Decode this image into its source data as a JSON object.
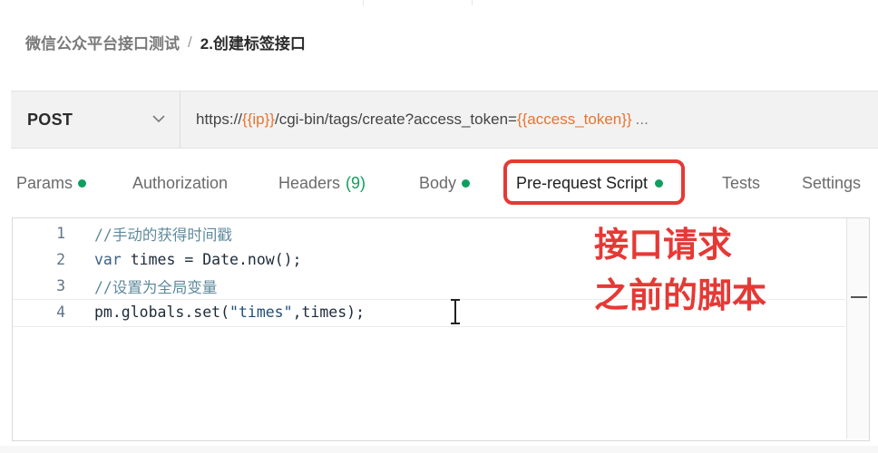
{
  "breadcrumb": {
    "parent": "微信公众平台接口测试",
    "separator": "/",
    "current": "2.创建标签接口"
  },
  "request": {
    "method": "POST",
    "url": {
      "prefix": "https://",
      "var_ip": "{{ip}}",
      "path": "/cgi-bin/tags/create?access_token=",
      "var_token": "{{access_token}}",
      "ellipsis": "..."
    }
  },
  "tabs": {
    "params": "Params",
    "authorization": "Authorization",
    "headers": "Headers",
    "headers_count": "(9)",
    "body": "Body",
    "prerequest": "Pre-request Script",
    "tests": "Tests",
    "settings": "Settings"
  },
  "editor": {
    "lines": [
      {
        "num": "1",
        "comment": "//手动的获得时间戳"
      },
      {
        "num": "2",
        "kw": "var",
        "rest": " times = Date.now();"
      },
      {
        "num": "3",
        "comment": "//设置为全局变量"
      },
      {
        "num": "4",
        "pre": "pm.globals.set(",
        "str": "\"times\"",
        "post": ",times);"
      }
    ]
  },
  "annotation": {
    "line1": "接口请求",
    "line2": "之前的脚本"
  },
  "colors": {
    "accent_red": "#e53935",
    "variable_orange": "#e8742f",
    "status_green": "#0e9f5e"
  },
  "icons": [
    "chevron-down-icon",
    "text-cursor-icon"
  ]
}
